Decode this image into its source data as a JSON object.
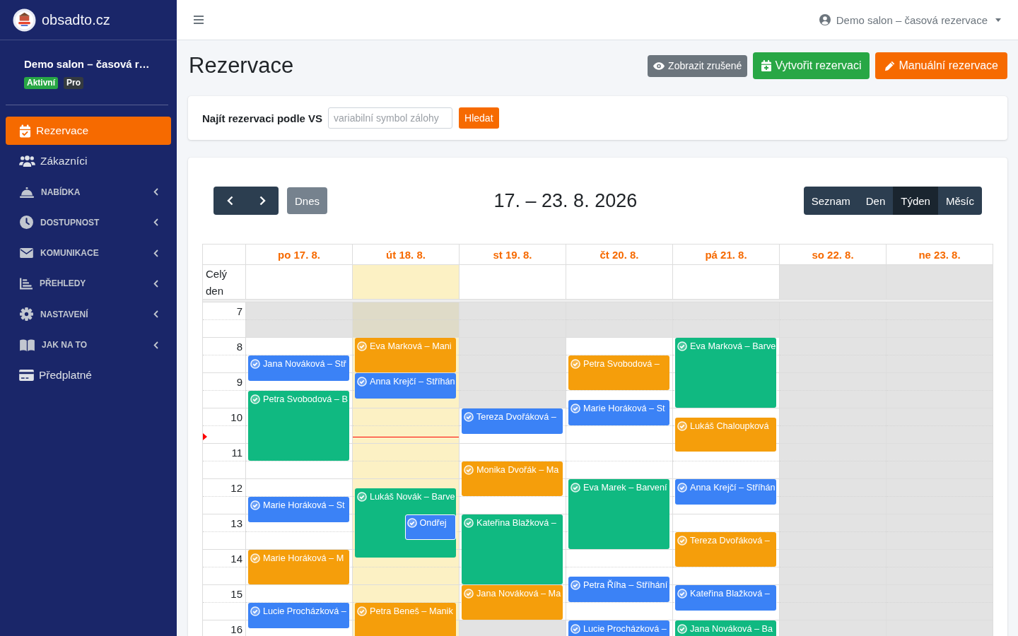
{
  "sidebar": {
    "brand": "obsadto.cz",
    "account": {
      "name": "Demo salon – časová r…",
      "badges": [
        {
          "label": "Aktivní",
          "kind": "status"
        },
        {
          "label": "Pro",
          "kind": "plan"
        }
      ]
    },
    "items": [
      {
        "label": "Rezervace",
        "kind": "link",
        "selected": true
      },
      {
        "label": "Zákazníci",
        "kind": "link",
        "selected": false
      },
      {
        "label": "NABÍDKA",
        "kind": "group",
        "selected": false,
        "expanded": false
      },
      {
        "label": "DOSTUPNOST",
        "kind": "group",
        "selected": false,
        "expanded": false
      },
      {
        "label": "KOMUNIKACE",
        "kind": "group",
        "selected": false,
        "expanded": false
      },
      {
        "label": "PŘEHLEDY",
        "kind": "group",
        "selected": false,
        "expanded": false
      },
      {
        "label": "NASTAVENÍ",
        "kind": "group",
        "selected": false,
        "expanded": false
      },
      {
        "label": "JAK NA TO",
        "kind": "group",
        "selected": false,
        "expanded": false
      },
      {
        "label": "Předplatné",
        "kind": "link",
        "selected": false
      }
    ]
  },
  "topbar": {
    "user": "Demo salon – časová rezervace"
  },
  "page": {
    "title": "Rezervace",
    "buttons": [
      {
        "label": "Zobrazit zrušené",
        "kind": "secondary"
      },
      {
        "label": "Vytvořit rezervaci",
        "kind": "success"
      },
      {
        "label": "Manuální rezervace",
        "kind": "primary"
      }
    ]
  },
  "search": {
    "label": "Najít rezervaci podle VS",
    "placeholder": "variabilní symbol zálohy",
    "button": "Hledat"
  },
  "calendar": {
    "today_button": {
      "label": "Dnes",
      "disabled": true
    },
    "title": "17. – 23. 8. 2026",
    "views": [
      {
        "label": "Seznam",
        "selected": false
      },
      {
        "label": "Den",
        "selected": false
      },
      {
        "label": "Týden",
        "selected": true
      },
      {
        "label": "Měsíc",
        "selected": false
      }
    ],
    "all_day_label": "Celý den",
    "hours": [
      "7",
      "8",
      "9",
      "10",
      "11",
      "12",
      "13",
      "14",
      "15",
      "16"
    ],
    "days": [
      {
        "label": "po 17. 8.",
        "today": false,
        "open_hours": [
          false,
          true,
          true,
          true,
          true,
          true,
          true,
          true,
          true,
          true
        ],
        "events": [
          {
            "title": "Jana Nováková – Stř",
            "color": "#3b82f6"
          },
          {
            "title": "Petra Svobodová – B",
            "color": "#10b981"
          },
          {
            "title": "Marie Horáková – St",
            "color": "#3b82f6"
          },
          {
            "title": "Marie Horáková – M",
            "color": "#f59e0b"
          },
          {
            "title": "Lucie Procházková –",
            "color": "#3b82f6"
          }
        ]
      },
      {
        "label": "út 18. 8.",
        "today": true,
        "open_hours": [
          false,
          true,
          true,
          true,
          true,
          true,
          true,
          true,
          true,
          true
        ],
        "events": [
          {
            "title": "Eva Marková – Mani",
            "color": "#f59e0b"
          },
          {
            "title": "Anna Krejčí – Stříhán",
            "color": "#3b82f6"
          },
          {
            "title": "Lukáš Novák – Barve",
            "color": "#10b981"
          },
          {
            "title": "Ondřej",
            "color": "#3b82f6"
          },
          {
            "title": "Petra Beneš – Manik",
            "color": "#f59e0b"
          }
        ]
      },
      {
        "label": "st 19. 8.",
        "today": false,
        "open_hours": [
          false,
          false,
          false,
          true,
          true,
          true,
          true,
          true,
          true,
          false
        ],
        "events": [
          {
            "title": "Tereza Dvořáková –",
            "color": "#3b82f6"
          },
          {
            "title": "Monika Dvořák – Ma",
            "color": "#f59e0b"
          },
          {
            "title": "Kateřina Blažková –",
            "color": "#10b981"
          },
          {
            "title": "Jana Nováková – Ma",
            "color": "#f59e0b"
          }
        ]
      },
      {
        "label": "čt 20. 8.",
        "today": false,
        "open_hours": [
          false,
          true,
          true,
          true,
          true,
          true,
          true,
          true,
          true,
          true
        ],
        "events": [
          {
            "title": "Petra Svobodová –",
            "color": "#f59e0b"
          },
          {
            "title": "Marie Horáková – St",
            "color": "#3b82f6"
          },
          {
            "title": "Eva Marek – Barvení",
            "color": "#10b981"
          },
          {
            "title": "Petra Říha – Stříhání",
            "color": "#3b82f6"
          },
          {
            "title": "Lucie Procházková –",
            "color": "#3b82f6"
          }
        ]
      },
      {
        "label": "pá 21. 8.",
        "today": false,
        "open_hours": [
          false,
          true,
          true,
          true,
          true,
          true,
          true,
          true,
          true,
          true
        ],
        "events": [
          {
            "title": "Eva Marková – Barve",
            "color": "#10b981"
          },
          {
            "title": "Lukáš Chaloupková",
            "color": "#f59e0b"
          },
          {
            "title": "Anna Krejčí – Stříhán",
            "color": "#3b82f6"
          },
          {
            "title": "Tereza Dvořáková –",
            "color": "#f59e0b"
          },
          {
            "title": "Kateřina Blažková –",
            "color": "#3b82f6"
          },
          {
            "title": "Jana Nováková – Ba",
            "color": "#10b981"
          }
        ]
      },
      {
        "label": "so 22. 8.",
        "today": false,
        "open_hours": [
          false,
          false,
          false,
          false,
          false,
          false,
          false,
          false,
          false,
          false
        ]
      },
      {
        "label": "ne 23. 8.",
        "today": false,
        "open_hours": [
          false,
          false,
          false,
          false,
          false,
          false,
          false,
          false,
          false,
          false
        ]
      }
    ]
  }
}
